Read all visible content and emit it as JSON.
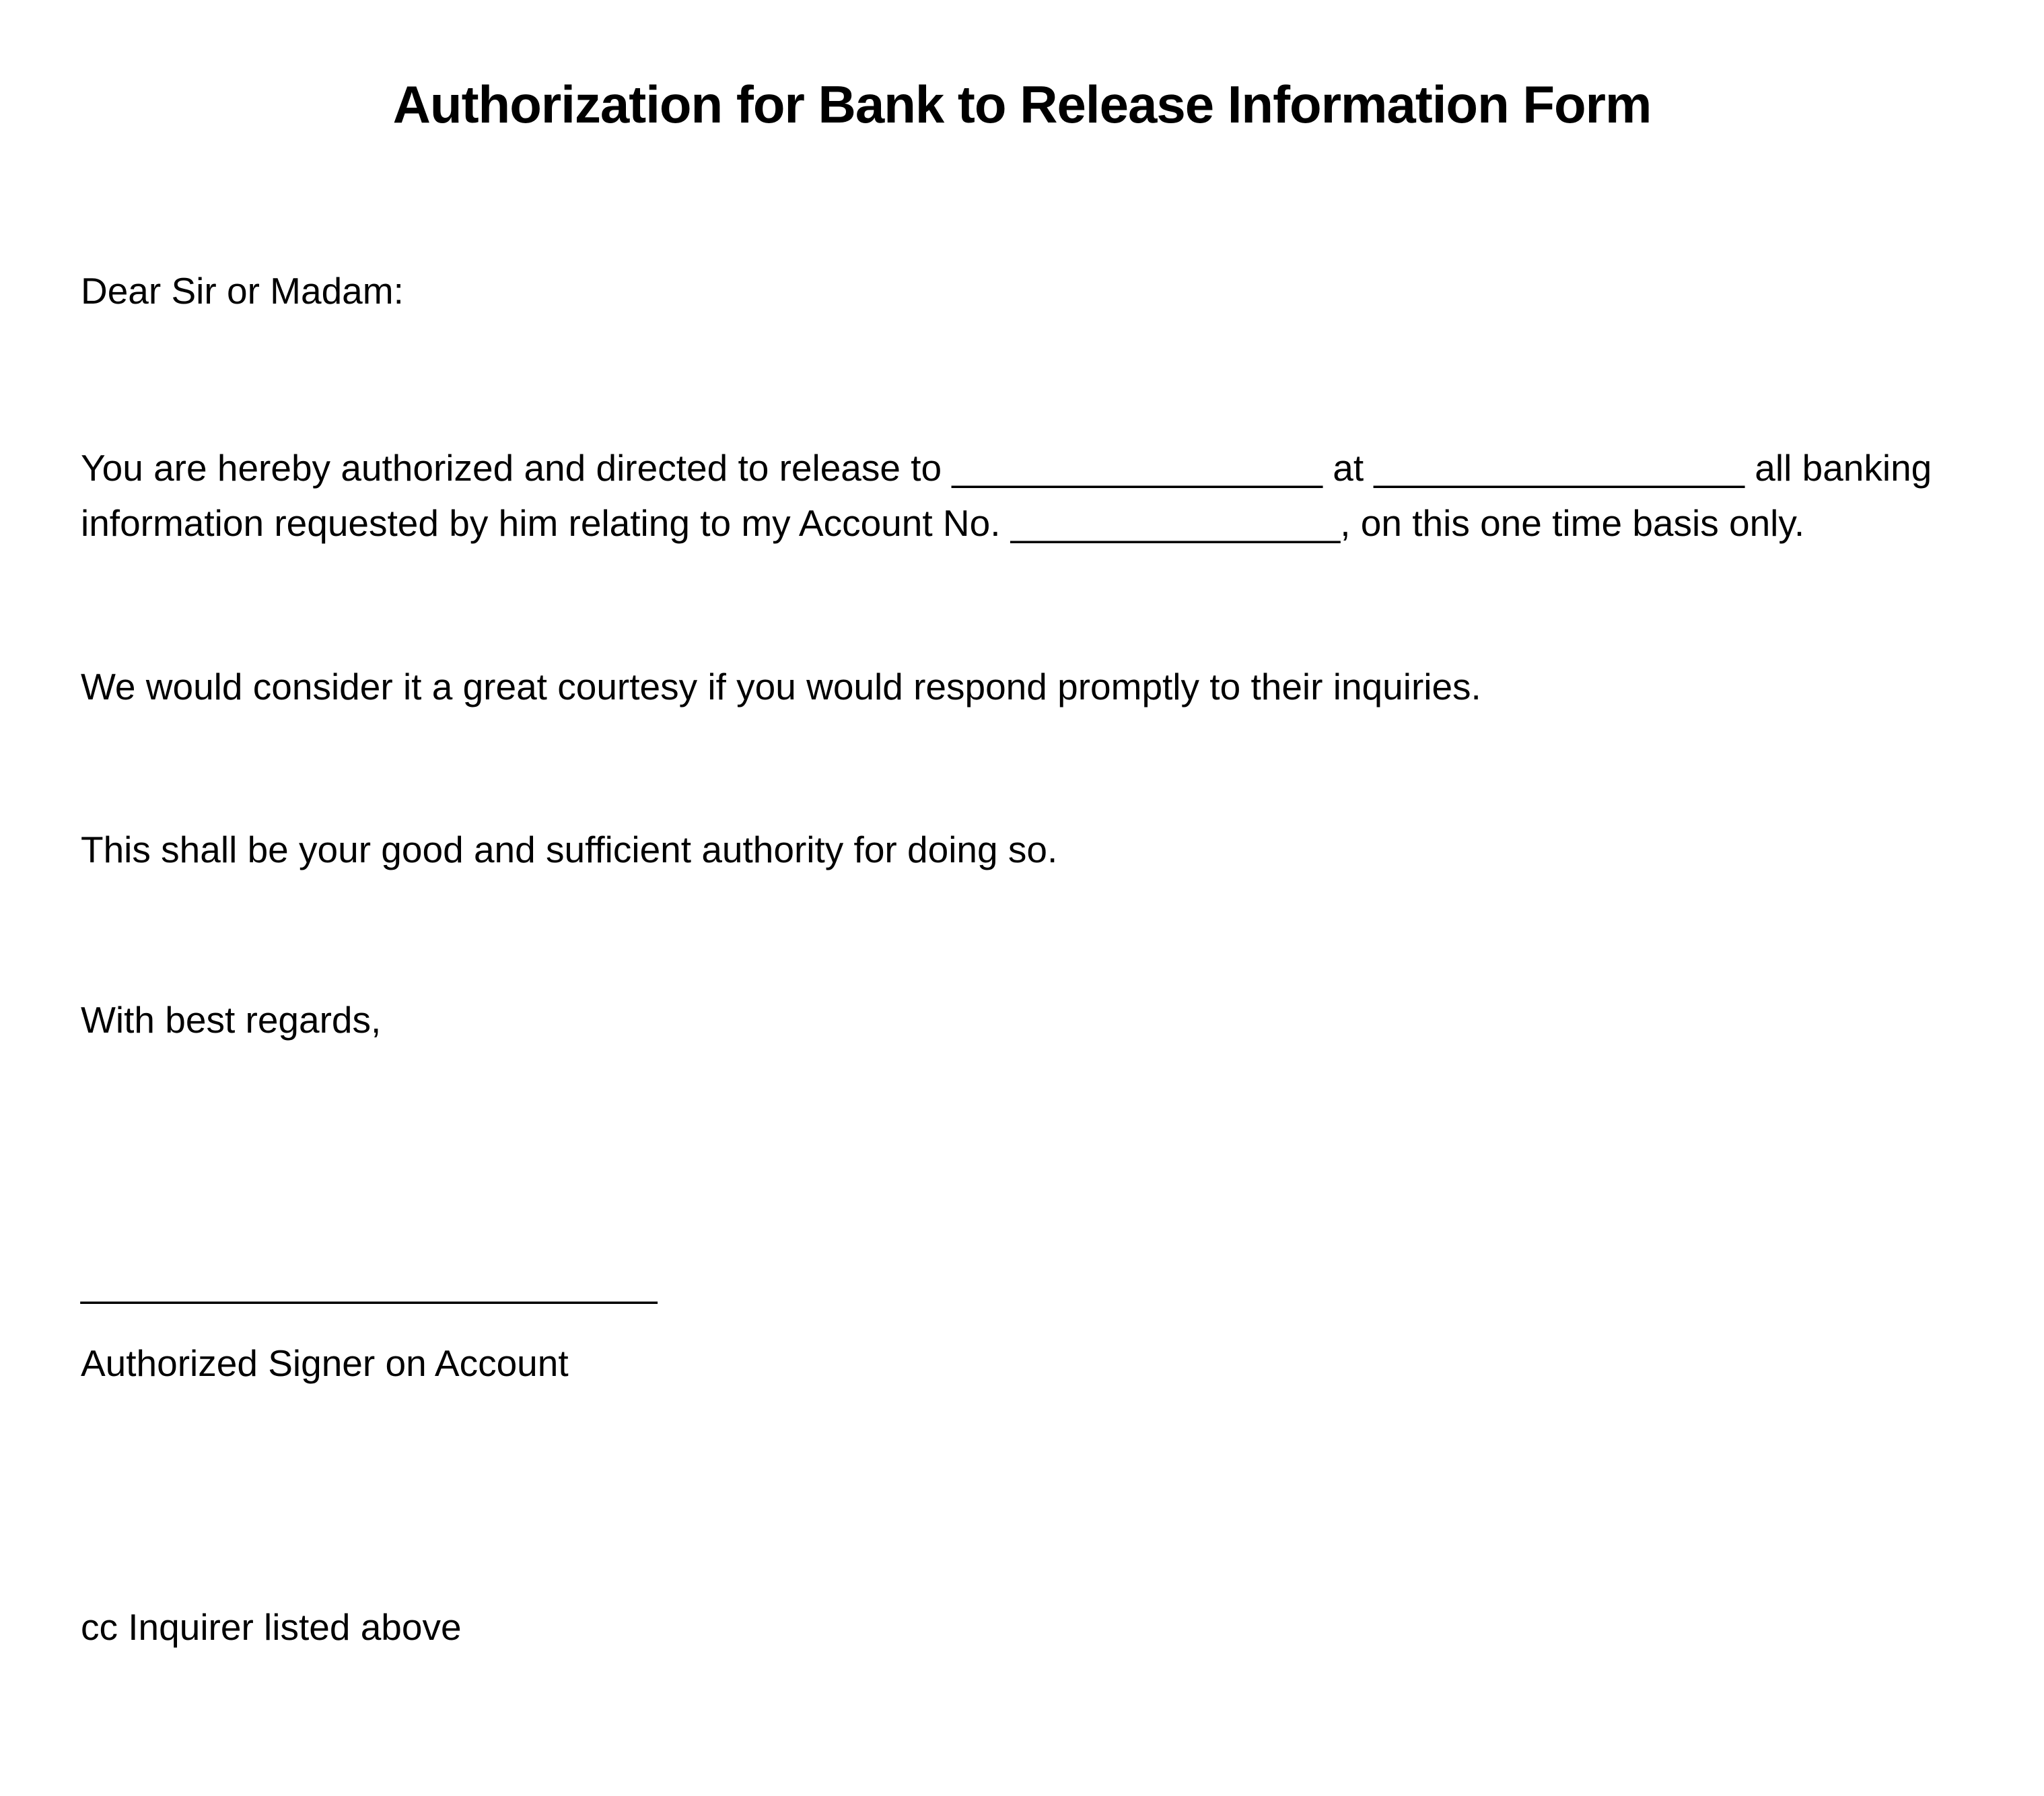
{
  "title": "Authorization for Bank to Release Information Form",
  "salutation": "Dear Sir or Madam:",
  "paragraph1": "You are hereby authorized and directed to release to __________________ at __________________ all banking information requested by him relating to my Account No. ________________, on this one time basis only.",
  "paragraph2": "We would consider it a great courtesy if you would respond promptly to their inquiries.",
  "paragraph3": "This shall be your good and sufficient authority for doing so.",
  "regards": "With best regards,",
  "signature_line": "____________________________",
  "signer_label": "Authorized Signer on Account",
  "cc_line": "cc Inquirer listed above"
}
